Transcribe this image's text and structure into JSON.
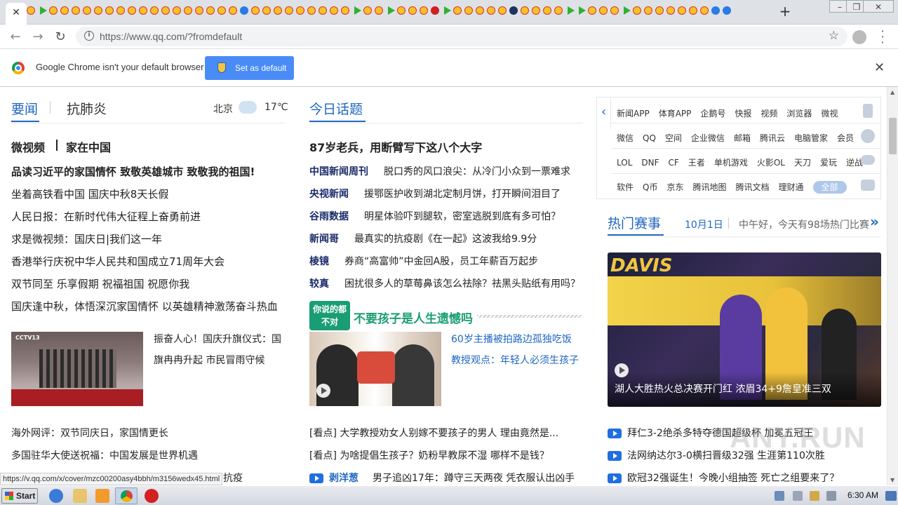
{
  "browser": {
    "url": "https://www.qq.com/?fromdefault",
    "infobar_text": "Google Chrome isn't your default browser",
    "set_default_label": "Set as default",
    "status_url": "https://v.qq.com/x/cover/mzc00200asy4bbh/m3156wedx45.html"
  },
  "left": {
    "tab1": "要闻",
    "tab2": "抗肺炎",
    "city": "北京",
    "temp": "17℃",
    "top_title_a": "微视频",
    "top_title_b": "家在中国",
    "lead": "品读习近平的家国情怀 致敬英雄城市 致敬我的祖国!",
    "news": [
      "坐着高铁看中国 国庆中秋8天长假",
      "人民日报：在新时代伟大征程上奋勇前进",
      "求是微视频：国庆日|我们这一年",
      "香港举行庆祝中华人民共和国成立71周年大会",
      "双节同至 乐享假期 祝福祖国 祝愿你我",
      "国庆逢中秋，体悟深沉家国情怀 以英雄精神激荡奋斗热血"
    ],
    "feature_caption_1": "振奋人心！国庆升旗仪式：国",
    "feature_caption_2": "旗冉冉升起 市民冒雨守候",
    "feature_img_label": "CCTV13",
    "bottom": [
      "海外网评：双节同庆日，家国情更长",
      "多国驻华大使送祝福：中国发展是世界机遇"
    ],
    "cut_line": "抗疫"
  },
  "middle": {
    "tab": "今日话题",
    "headline": "87岁老兵，用断臂写下这八个大字",
    "items": [
      {
        "src": "中国新闻周刊",
        "text": "脱口秀的风口浪尖：从冷门小众到一票难求"
      },
      {
        "src": "央视新闻",
        "text": "援鄂医护收到湖北定制月饼，打开瞬间泪目了"
      },
      {
        "src": "谷雨数据",
        "text": "明星体验吓到腿软，密室逃脱到底有多可怕？"
      },
      {
        "src": "新闻哥",
        "text": "最真实的抗疫剧《在一起》这波我给9.9分"
      },
      {
        "src": "棱镜",
        "text": "券商“高富帅”中金回A股，员工年薪百万起步"
      },
      {
        "src": "较真",
        "text": "困扰很多人的草莓鼻该怎么祛除？祛黑头贴纸有用吗？"
      }
    ],
    "banner_logo": "你说的都不对",
    "banner_title": "不要孩子是人生遗憾吗",
    "feature_1": "60岁主播被拍路边孤独吃饭",
    "feature_2": "教授观点：年轻人必须生孩子",
    "bottom": [
      "[看点] 大学教授劝女人别嫁不要孩子的男人 理由竟然是...",
      "[看点] 为啥提倡生孩子？奶粉早教尿不湿 哪样不是钱？"
    ],
    "bottom_src": "剥洋葱",
    "bottom_src_text": "男子追凶17年：蹲守三天两夜 凭衣服认出凶手"
  },
  "right": {
    "nav_rows": [
      [
        "新闻APP",
        "体育APP",
        "企鹅号",
        "快报",
        "视频",
        "浏览器",
        "微视"
      ],
      [
        "微信",
        "QQ",
        "空间",
        "企业微信",
        "邮箱",
        "腾讯云",
        "电脑管家",
        "会员"
      ],
      [
        "LOL",
        "DNF",
        "CF",
        "王者",
        "单机游戏",
        "火影OL",
        "天刀",
        "爱玩",
        "逆战"
      ],
      [
        "软件",
        "Q币",
        "京东",
        "腾讯地图",
        "腾讯文档",
        "理财通"
      ]
    ],
    "all_label": "全部",
    "sports_title": "热门赛事",
    "sports_date": "10月1日",
    "sports_tagline": "中午好，今天有98场热门比赛",
    "photo_caption": "湖人大胜热火总决赛开门红 浓眉34+9詹皇准三双",
    "photo_text": "DAVIS",
    "video_items": [
      "拜仁3-2绝杀多特夺德国超级杯 加冕五冠王",
      "法网纳达尔3-0横扫晋级32强 生涯第110次胜",
      "欧冠32强诞生！今晚小组抽签 死亡之组要来了？"
    ]
  },
  "taskbar": {
    "start": "Start",
    "clock": "6:30 AM"
  },
  "colors": {
    "accent": "#1f66c1",
    "chrome_button": "#4a8cf7"
  }
}
